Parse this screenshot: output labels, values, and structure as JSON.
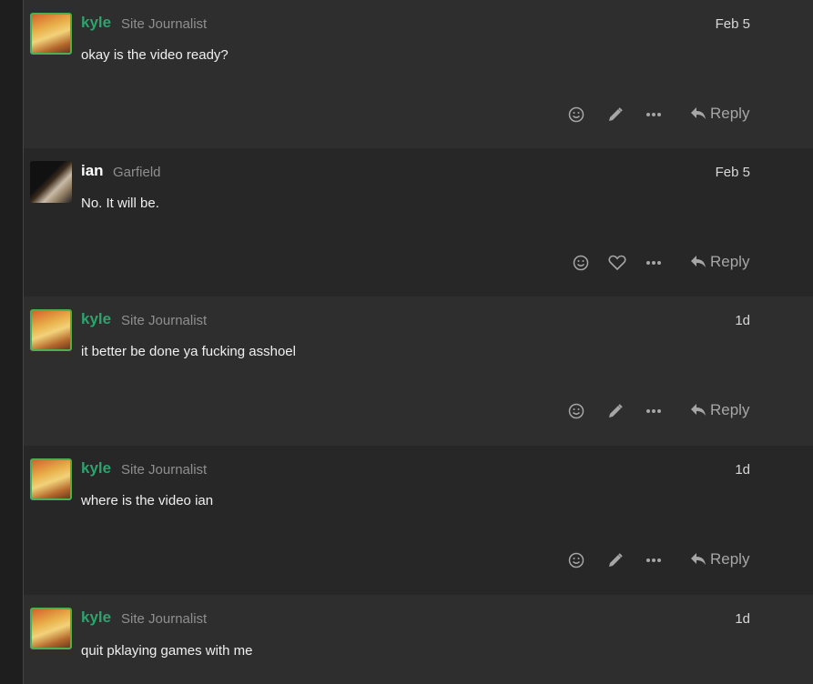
{
  "posts": [
    {
      "username": "kyle",
      "user_title": "Site Journalist",
      "date": "Feb 5",
      "body": "okay is the video ready?",
      "avatar": "kyle",
      "actions": [
        "smile-icon",
        "pencil-icon",
        "more-icon"
      ],
      "reply_label": "Reply"
    },
    {
      "username": "ian",
      "user_title": "Garfield",
      "date": "Feb 5",
      "body": "No. It will be.",
      "avatar": "ian",
      "actions": [
        "smile-icon",
        "heart-icon",
        "more-icon"
      ],
      "reply_label": "Reply"
    },
    {
      "username": "kyle",
      "user_title": "Site Journalist",
      "date": "1d",
      "body": "it better be done ya fucking asshoel",
      "avatar": "kyle",
      "actions": [
        "smile-icon",
        "pencil-icon",
        "more-icon"
      ],
      "reply_label": "Reply"
    },
    {
      "username": "kyle",
      "user_title": "Site Journalist",
      "date": "1d",
      "body": "where is the video ian",
      "avatar": "kyle",
      "actions": [
        "smile-icon",
        "pencil-icon",
        "more-icon"
      ],
      "reply_label": "Reply"
    },
    {
      "username": "kyle",
      "user_title": "Site Journalist",
      "date": "1d",
      "body": "quit pklaying games with me",
      "avatar": "kyle",
      "actions": [],
      "reply_label": ""
    }
  ],
  "colors": {
    "accent_green": "#2da36d",
    "icon_gray": "#a6a6a6"
  }
}
